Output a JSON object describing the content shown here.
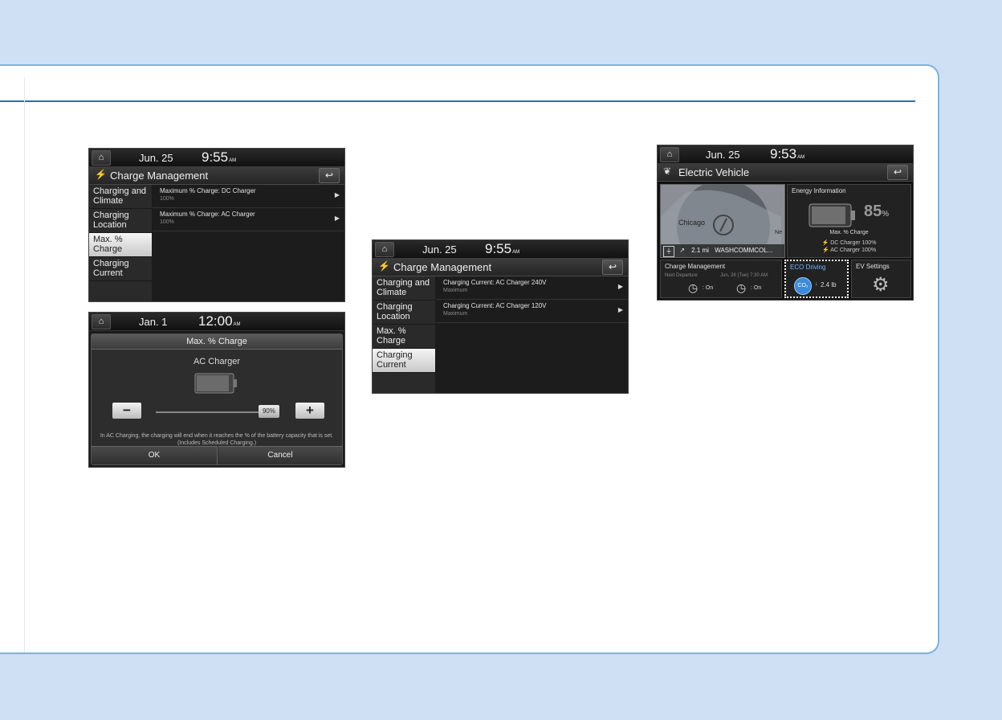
{
  "screen1": {
    "date": "Jun. 25",
    "time": "9:55",
    "ampm": "AM",
    "title": "Charge Management",
    "menu": [
      {
        "line1": "Charging and",
        "line2": "Climate"
      },
      {
        "line1": "Charging",
        "line2": "Location"
      },
      {
        "line1": "Max. %",
        "line2": "Charge"
      },
      {
        "line1": "Charging",
        "line2": "Current"
      }
    ],
    "active_index": 2,
    "rows": [
      {
        "title": "Maximum % Charge: DC Charger",
        "value": "100%"
      },
      {
        "title": "Maximum % Charge: AC Charger",
        "value": "100%"
      }
    ]
  },
  "screen2": {
    "date": "Jan.  1",
    "time": "12:00",
    "ampm": "AM",
    "popup_title": "Max. % Charge",
    "subtitle": "AC Charger",
    "minus": "−",
    "plus": "+",
    "slider_label": "90%",
    "slider_value": 90,
    "note": "In AC Charging, the charging will end when it reaches the % of the battery capacity that is  set. (Includes Scheduled Charging.)",
    "ok": "OK",
    "cancel": "Cancel"
  },
  "screen3": {
    "date": "Jun. 25",
    "time": "9:55",
    "ampm": "AM",
    "title": "Charge Management",
    "menu": [
      {
        "line1": "Charging and",
        "line2": "Climate"
      },
      {
        "line1": "Charging",
        "line2": "Location"
      },
      {
        "line1": "Max. %",
        "line2": "Charge"
      },
      {
        "line1": "Charging",
        "line2": "Current"
      }
    ],
    "active_index": 3,
    "rows": [
      {
        "title": "Charging Current: AC Charger 240V",
        "value": "Maximum"
      },
      {
        "title": "Charging Current: AC Charger 120V",
        "value": "Maximum"
      }
    ]
  },
  "screen4": {
    "date": "Jun. 25",
    "time": "9:53",
    "ampm": "AM",
    "title": "Electric Vehicle",
    "map_label": "Chicago",
    "map_dist": "2.1 mi",
    "map_dest": "WASHCOMMCOL...",
    "map_corner": "Ne",
    "energy_title": "Energy Information",
    "battery_pct": "85",
    "battery_unit": "%",
    "max_charge_label": "Max. % Charge",
    "dc_line": "DC Charger 100%",
    "ac_line": "AC Charger 100%",
    "charge_mgmt": "Charge Management",
    "next_departure": "Next Departure",
    "departure_time": "Jun. 26 (Tue) 7:30 AM",
    "timer1": ": On",
    "timer2": ": On",
    "eco_title": "ECO Driving",
    "co2": "CO₂",
    "eco_value": "2.4 lb",
    "ev_settings": "EV Settings"
  }
}
